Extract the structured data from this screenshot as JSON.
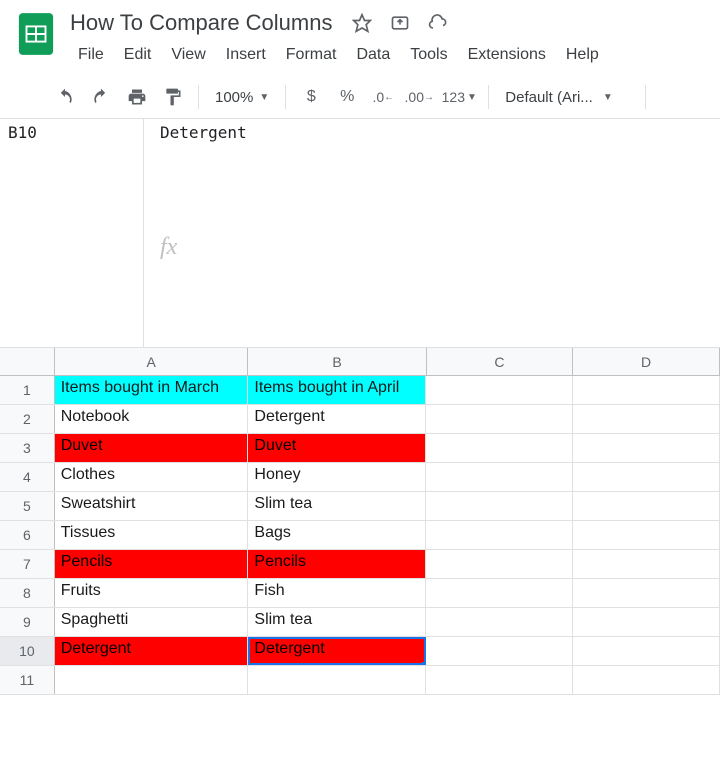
{
  "doc": {
    "title": "How To Compare Columns"
  },
  "menu": {
    "file": "File",
    "edit": "Edit",
    "view": "View",
    "insert": "Insert",
    "format": "Format",
    "data": "Data",
    "tools": "Tools",
    "extensions": "Extensions",
    "help": "Help"
  },
  "toolbar": {
    "zoom": "100%",
    "currency": "$",
    "percent": "%",
    "dec_dec": ".0",
    "inc_dec": ".00",
    "num123": "123",
    "font": "Default (Ari..."
  },
  "selection": {
    "name": "B10",
    "formula_value": "Detergent",
    "fx": "fx"
  },
  "cols": [
    "A",
    "B",
    "C",
    "D"
  ],
  "rows": [
    {
      "n": "1",
      "a": "Items bought in March",
      "b": "Items bought in April",
      "cls": "hdr"
    },
    {
      "n": "2",
      "a": "Notebook",
      "b": "Detergent",
      "cls": ""
    },
    {
      "n": "3",
      "a": "Duvet",
      "b": "Duvet",
      "cls": "red"
    },
    {
      "n": "4",
      "a": "Clothes",
      "b": "Honey",
      "cls": ""
    },
    {
      "n": "5",
      "a": "Sweatshirt",
      "b": "Slim tea",
      "cls": ""
    },
    {
      "n": "6",
      "a": "Tissues",
      "b": "Bags",
      "cls": ""
    },
    {
      "n": "7",
      "a": "Pencils",
      "b": "Pencils",
      "cls": "red"
    },
    {
      "n": "8",
      "a": "Fruits",
      "b": "Fish",
      "cls": ""
    },
    {
      "n": "9",
      "a": "Spaghetti",
      "b": "Slim tea",
      "cls": ""
    },
    {
      "n": "10",
      "a": "Detergent",
      "b": "Detergent",
      "cls": "red",
      "sel": true
    },
    {
      "n": "11",
      "a": "",
      "b": "",
      "cls": ""
    }
  ]
}
